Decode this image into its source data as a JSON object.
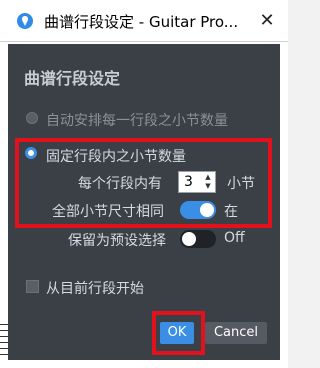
{
  "window": {
    "title": "曲谱行段设定 - Guitar Pro...",
    "close_glyph": "✕",
    "icon": "guitar-pro-icon"
  },
  "dialog": {
    "heading": "曲谱行段设定",
    "options": {
      "auto_bars": {
        "label": "自动安排每一行段之小节数量",
        "selected": false
      },
      "fixed_bars": {
        "label": "固定行段内之小节数量",
        "selected": true
      }
    },
    "bars_per_system": {
      "prefix": "每个行段内有",
      "value": "3",
      "suffix": "小节"
    },
    "same_size": {
      "label": "全部小节尺寸相同",
      "state_label": "在",
      "on": true
    },
    "save_default": {
      "label": "保留为预设选择",
      "state_label": "Off",
      "on": false
    },
    "start_from_current": {
      "label": "从目前行段开始",
      "checked": false
    },
    "buttons": {
      "ok": "OK",
      "cancel": "Cancel"
    }
  },
  "colors": {
    "panel_bg": "#3b3f46",
    "accent": "#3a8ee6",
    "highlight_box": "#e1121b"
  }
}
